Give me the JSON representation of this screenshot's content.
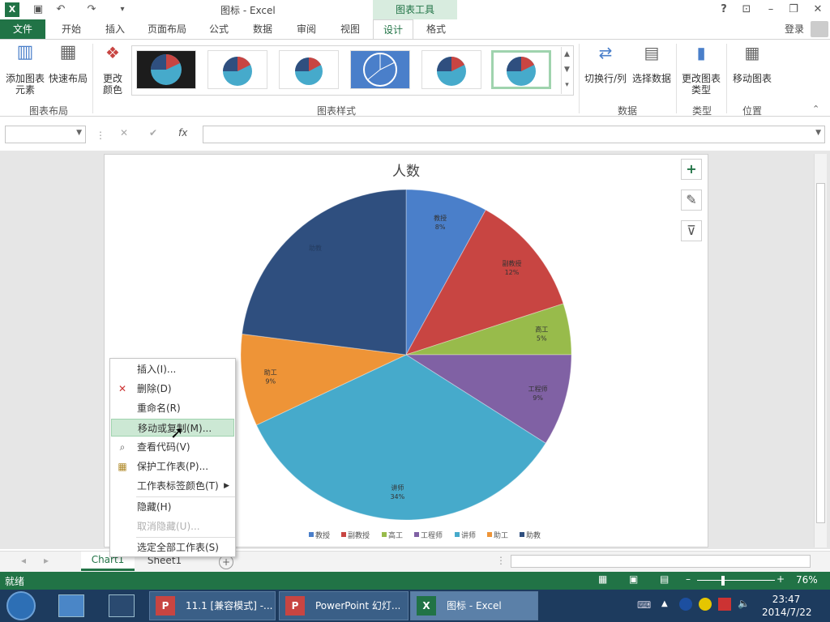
{
  "titlebar": {
    "title": "图标 - Excel",
    "context_tab": "图表工具",
    "help": "?",
    "min": "–",
    "restore": "❐",
    "close": "✕"
  },
  "tabs": [
    "文件",
    "开始",
    "插入",
    "页面布局",
    "公式",
    "数据",
    "审阅",
    "视图",
    "设计",
    "格式"
  ],
  "login": "登录",
  "ribbon": {
    "add_element": "添加图表元素",
    "quick_layout": "快速布局",
    "change_color": "更改颜色",
    "group_layout": "图表布局",
    "group_styles": "图表样式",
    "switch_rowcol": "切换行/列",
    "select_data": "选择数据",
    "group_data": "数据",
    "change_type": "更改图表类型",
    "group_type": "类型",
    "move_chart": "移动图表",
    "group_location": "位置"
  },
  "formula": {
    "fx": "fx",
    "cancel": "✕",
    "enter": "✔"
  },
  "chart_data": {
    "type": "pie",
    "title": "人数",
    "categories": [
      "教授",
      "副教授",
      "高工",
      "工程师",
      "讲师",
      "助工",
      "助教"
    ],
    "values": [
      8,
      12,
      5,
      9,
      34,
      9,
      23
    ],
    "labels": [
      "8%",
      "12%",
      "5%",
      "9%",
      "34%",
      "9%",
      ""
    ],
    "colors": [
      "#4a7fca",
      "#c84542",
      "#98bb4b",
      "#8061a4",
      "#46aacb",
      "#ee9437",
      "#2f4f7f"
    ],
    "legend": "bottom"
  },
  "context_menu": [
    {
      "label": "插入(I)...",
      "enabled": true
    },
    {
      "label": "删除(D)",
      "enabled": true,
      "icon": "delete-sheet-icon"
    },
    {
      "label": "重命名(R)",
      "enabled": true
    },
    {
      "label": "移动或复制(M)...",
      "enabled": true,
      "hover": true
    },
    {
      "label": "查看代码(V)",
      "enabled": true,
      "icon": "view-code-icon"
    },
    {
      "label": "保护工作表(P)...",
      "enabled": true,
      "icon": "protect-sheet-icon"
    },
    {
      "label": "工作表标签颜色(T)",
      "enabled": true,
      "submenu": true
    },
    {
      "label": "隐藏(H)",
      "enabled": true
    },
    {
      "label": "取消隐藏(U)...",
      "enabled": false
    },
    {
      "label": "选定全部工作表(S)",
      "enabled": true
    }
  ],
  "sheet_tabs": [
    "Chart1",
    "Sheet1"
  ],
  "status": {
    "ready": "就绪",
    "zoom": "76%"
  },
  "taskbar": {
    "items": [
      "11.1 [兼容模式] -...",
      "PowerPoint 幻灯...",
      "图标 - Excel"
    ],
    "time": "23:47",
    "date": "2014/7/22"
  }
}
